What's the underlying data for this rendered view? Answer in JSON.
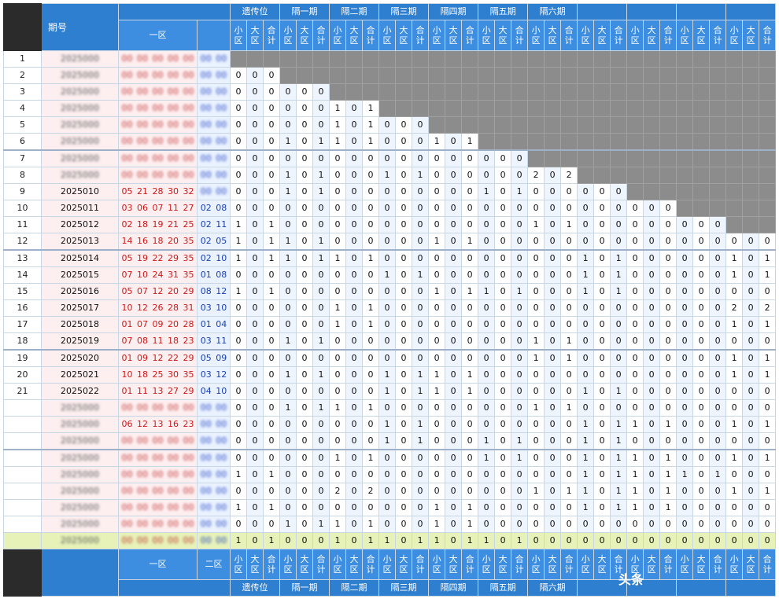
{
  "header": {
    "issue_label": "期号",
    "zone1_label": "一区",
    "zone2_label": "二区",
    "groups": [
      "遗传位",
      "隔一期",
      "隔二期",
      "隔三期",
      "隔四期",
      "隔五期",
      "隔六期",
      "",
      "",
      "",
      ""
    ],
    "sub_labels": [
      "小区",
      "大区",
      "合计"
    ]
  },
  "colors": {
    "header_blue": "#2f7fd0",
    "zone1_red": "#d01818",
    "zone2_blue": "#1a3fb0",
    "masked_gray": "#8c8c8c",
    "summary_row": "#e6f2b8"
  },
  "rows": [
    {
      "n": "1",
      "issue": "",
      "z1": "",
      "z2": "",
      "vals": "",
      "masked": true
    },
    {
      "n": "2",
      "issue": "",
      "z1": "",
      "z2": "",
      "vals": "000",
      "masked": true
    },
    {
      "n": "3",
      "issue": "",
      "z1": "",
      "z2": "",
      "vals": "000000",
      "masked": true
    },
    {
      "n": "4",
      "issue": "",
      "z1": "",
      "z2": "",
      "vals": "000000101",
      "masked": true
    },
    {
      "n": "5",
      "issue": "",
      "z1": "",
      "z2": "",
      "vals": "000000101000",
      "masked": true
    },
    {
      "n": "6",
      "issue": "",
      "z1": "",
      "z2": "",
      "vals": "000101101000101",
      "masked": true
    },
    {
      "n": "7",
      "issue": "",
      "z1": "",
      "z2": "",
      "vals": "000000000000000000",
      "masked": true
    },
    {
      "n": "8",
      "issue": "",
      "z1": "",
      "z2": "",
      "vals": "000101000101000000202",
      "masked": true
    },
    {
      "n": "9",
      "issue": "2025010",
      "z1": "05 21 28 30 32",
      "z2": "",
      "vals": "000101000000000101000000",
      "z2masked": true
    },
    {
      "n": "10",
      "issue": "2025011",
      "z1": "03 06 07 11 27",
      "z2": "02 08",
      "vals": "000000000000000000000000000"
    },
    {
      "n": "11",
      "issue": "2025012",
      "z1": "02 18 19 21 25",
      "z2": "02 11",
      "vals": "101000000000000000101000000000"
    },
    {
      "n": "12",
      "issue": "2025013",
      "z1": "14 16 18 20 35",
      "z2": "02 05",
      "vals": "101101000000101000000000000000000"
    },
    {
      "n": "13",
      "issue": "2025014",
      "z1": "05 19 22 29 35",
      "z2": "02 10",
      "vals": "101101101000000000000101000000101"
    },
    {
      "n": "14",
      "issue": "2025015",
      "z1": "07 10 24 31 35",
      "z2": "01 08",
      "vals": "000000000101000000000101000000101"
    },
    {
      "n": "15",
      "issue": "2025016",
      "z1": "05 07 12 20 29",
      "z2": "08 12",
      "vals": "101000000000101101000101000000000"
    },
    {
      "n": "16",
      "issue": "2025017",
      "z1": "10 12 26 28 31",
      "z2": "03 10",
      "vals": "000000101000000000000000000000202"
    },
    {
      "n": "17",
      "issue": "2025018",
      "z1": "01 07 09 20 28",
      "z2": "01 04",
      "vals": "000000101000000000000000000000101"
    },
    {
      "n": "18",
      "issue": "2025019",
      "z1": "07 08 11 18 23",
      "z2": "03 11",
      "vals": "000101000000000000101000000000000"
    },
    {
      "n": "19",
      "issue": "2025020",
      "z1": "01 09 12 22 29",
      "z2": "05 09",
      "vals": "000000000000000000101000000000101"
    },
    {
      "n": "20",
      "issue": "2025021",
      "z1": "10 18 25 30 35",
      "z2": "03 12",
      "vals": "000101000101101000000000000000101"
    },
    {
      "n": "21",
      "issue": "2025022",
      "z1": "01 11 13 27 29",
      "z2": "04 10",
      "vals": "000000000101101000000101000000000"
    },
    {
      "n": "",
      "issue": "",
      "z1": "",
      "z2": "",
      "vals": "000101101000000000101000000000000",
      "blur": true
    },
    {
      "n": "",
      "issue": "",
      "z1": "06 12 13 16 23",
      "z2": "",
      "vals": "000000000101000000000101101000101",
      "blur": true
    },
    {
      "n": "",
      "issue": "",
      "z1": "",
      "z2": "",
      "vals": "000000000101000101000101000000000",
      "blur": true
    },
    {
      "n": "",
      "issue": "",
      "z1": "",
      "z2": "",
      "vals": "000000101000000101000101101000101",
      "blur": true
    },
    {
      "n": "",
      "issue": "",
      "z1": "",
      "z2": "",
      "vals": "101000000000000000000101101101000",
      "blur": true
    },
    {
      "n": "",
      "issue": "",
      "z1": "",
      "z2": "",
      "vals": "000000202000000000101101101000101",
      "blur": true
    },
    {
      "n": "",
      "issue": "",
      "z1": "",
      "z2": "",
      "vals": "101000000000101000000101101000000",
      "blur": true
    },
    {
      "n": "",
      "issue": "",
      "z1": "",
      "z2": "",
      "vals": "000101101000101000000000000000000",
      "blur": true
    },
    {
      "n": "",
      "issue": "",
      "z1": "",
      "z2": "",
      "vals": "101000101101101101000000000000000",
      "blur": true,
      "summary": true
    }
  ],
  "footer": {
    "watermark": "头条"
  }
}
